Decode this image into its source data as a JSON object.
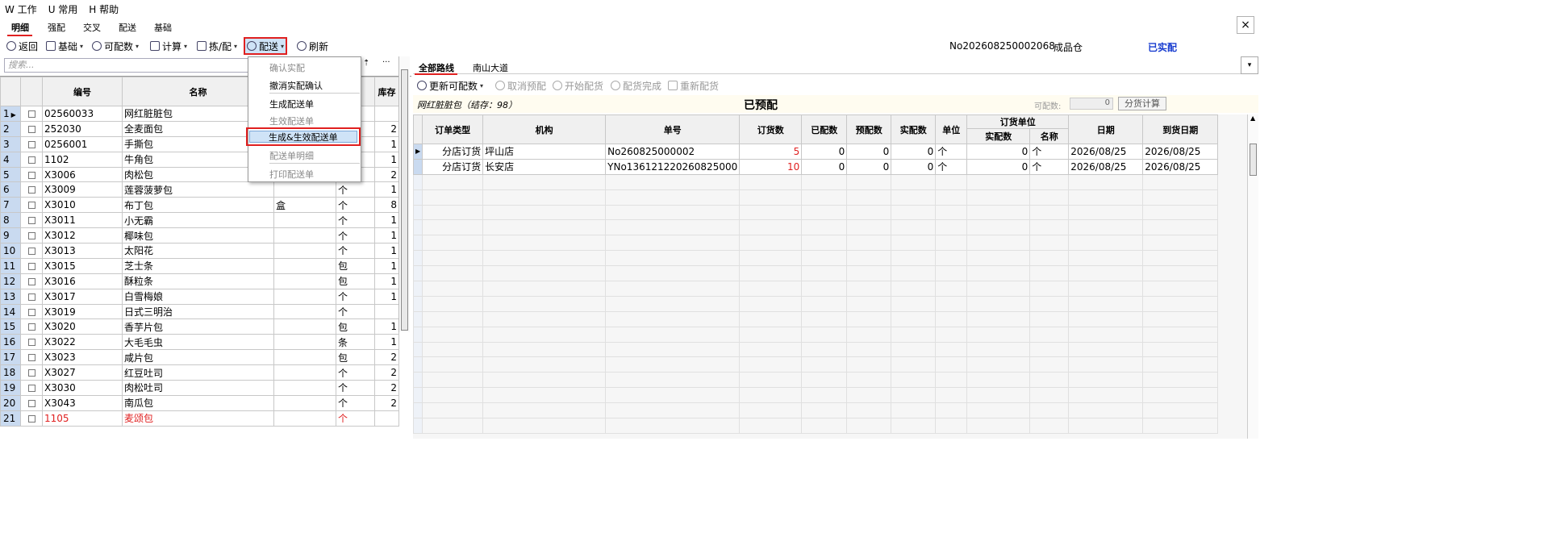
{
  "menubar": {
    "items": [
      "W 工作",
      "U 常用",
      "H 帮助"
    ]
  },
  "tabs": [
    "明细",
    "强配",
    "交叉",
    "配送",
    "基础"
  ],
  "close_label": "×",
  "toolbar": {
    "back": "返回",
    "basic": "基础",
    "available": "可配数",
    "calc": "计算",
    "pick": "拣/配",
    "deliver": "配送",
    "refresh": "刷新"
  },
  "header_info": {
    "order_no": "No202608250002068",
    "warehouse": "成品仓",
    "status": "已实配"
  },
  "search_placeholder": "搜索...",
  "left_grid": {
    "headers": [
      "编号",
      "名称",
      "",
      "",
      "库存"
    ],
    "rows": [
      {
        "n": "1",
        "code": "02560033",
        "name": "网红脏脏包",
        "spec": "",
        "unit": "",
        "stock": ""
      },
      {
        "n": "2",
        "code": "252030",
        "name": "全麦面包",
        "spec": "",
        "unit": "",
        "stock": "2"
      },
      {
        "n": "3",
        "code": "0256001",
        "name": "手撕包",
        "spec": "",
        "unit": "",
        "stock": "1"
      },
      {
        "n": "4",
        "code": "1102",
        "name": "牛角包",
        "spec": "",
        "unit": "",
        "stock": "1"
      },
      {
        "n": "5",
        "code": "X3006",
        "name": "肉松包",
        "spec": "",
        "unit": "",
        "stock": "2"
      },
      {
        "n": "6",
        "code": "X3009",
        "name": "莲蓉菠萝包",
        "spec": "",
        "unit": "个",
        "stock": "1"
      },
      {
        "n": "7",
        "code": "X3010",
        "name": "布丁包",
        "spec": "盒",
        "unit": "个",
        "stock": "8"
      },
      {
        "n": "8",
        "code": "X3011",
        "name": "小无霸",
        "spec": "",
        "unit": "个",
        "stock": "1"
      },
      {
        "n": "9",
        "code": "X3012",
        "name": "椰味包",
        "spec": "",
        "unit": "个",
        "stock": "1"
      },
      {
        "n": "10",
        "code": "X3013",
        "name": "太阳花",
        "spec": "",
        "unit": "个",
        "stock": "1"
      },
      {
        "n": "11",
        "code": "X3015",
        "name": "芝士条",
        "spec": "",
        "unit": "包",
        "stock": "1"
      },
      {
        "n": "12",
        "code": "X3016",
        "name": "酥粒条",
        "spec": "",
        "unit": "包",
        "stock": "1"
      },
      {
        "n": "13",
        "code": "X3017",
        "name": "白雪梅娘",
        "spec": "",
        "unit": "个",
        "stock": "1"
      },
      {
        "n": "14",
        "code": "X3019",
        "name": "日式三明治",
        "spec": "",
        "unit": "个",
        "stock": ""
      },
      {
        "n": "15",
        "code": "X3020",
        "name": "香芋片包",
        "spec": "",
        "unit": "包",
        "stock": "1"
      },
      {
        "n": "16",
        "code": "X3022",
        "name": "大毛毛虫",
        "spec": "",
        "unit": "条",
        "stock": "1"
      },
      {
        "n": "17",
        "code": "X3023",
        "name": "咸片包",
        "spec": "",
        "unit": "包",
        "stock": "2"
      },
      {
        "n": "18",
        "code": "X3027",
        "name": "红豆吐司",
        "spec": "",
        "unit": "个",
        "stock": "2"
      },
      {
        "n": "19",
        "code": "X3030",
        "name": "肉松吐司",
        "spec": "",
        "unit": "个",
        "stock": "2"
      },
      {
        "n": "20",
        "code": "X3043",
        "name": "南瓜包",
        "spec": "",
        "unit": "个",
        "stock": "2"
      },
      {
        "n": "21",
        "code": "1105",
        "name": "麦颂包",
        "spec": "",
        "unit": "个",
        "stock": "",
        "red": true
      }
    ]
  },
  "dropdown": {
    "items": [
      "确认实配",
      "撤消实配确认",
      "生成配送单",
      "生效配送单",
      "生成&生效配送单",
      "配送单明细",
      "打印配送单"
    ]
  },
  "right_tabs": [
    "全部路线",
    "南山大道"
  ],
  "right_toolbar": {
    "update": "更新可配数",
    "cancel": "取消预配",
    "start": "开始配货",
    "done": "配货完成",
    "redo": "重新配货"
  },
  "right_info": {
    "product": "网红脏脏包（结存：98）",
    "status": "已预配",
    "avail_label": "可配数:",
    "avail_value": "0",
    "calc_button": "分货计算"
  },
  "right_grid": {
    "headers": [
      "订单类型",
      "机构",
      "单号",
      "订货数",
      "已配数",
      "预配数",
      "实配数",
      "单位",
      "订货单位",
      "日期",
      "到货日期"
    ],
    "sub_headers": [
      "实配数",
      "名称"
    ],
    "rows": [
      {
        "type": "分店订货",
        "org": "坪山店",
        "no": "No260825000002",
        "order": "5",
        "allocated": "0",
        "pre": "0",
        "actual": "0",
        "unit": "个",
        "sub_actual": "0",
        "sub_name": "个",
        "date": "2026/08/25",
        "arrive": "2026/08/25"
      },
      {
        "type": "分店订货",
        "org": "长安店",
        "no": "YNo136121220260825000",
        "order": "10",
        "allocated": "0",
        "pre": "0",
        "actual": "0",
        "unit": "个",
        "sub_actual": "0",
        "sub_name": "个",
        "date": "2026/08/25",
        "arrive": "2026/08/25"
      }
    ]
  }
}
